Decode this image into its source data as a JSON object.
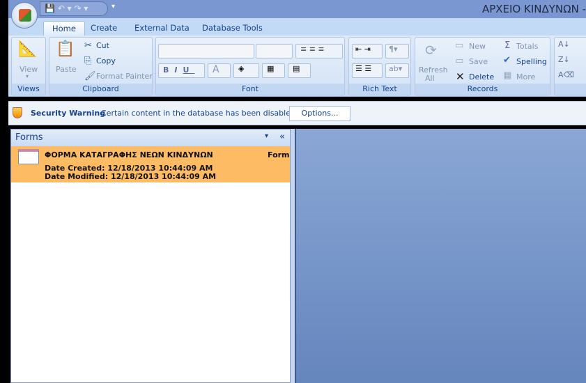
{
  "window": {
    "title": "ΑΡΧΕΙΟ ΚΙΝΔΥΝΩΝ -"
  },
  "tabs": [
    "Home",
    "Create",
    "External Data",
    "Database Tools"
  ],
  "ribbon": {
    "views": {
      "label": "Views",
      "view": "View"
    },
    "clipboard": {
      "label": "Clipboard",
      "paste": "Paste",
      "cut": "Cut",
      "copy": "Copy",
      "format_painter": "Format Painter"
    },
    "font": {
      "label": "Font",
      "bold": "B",
      "italic": "I",
      "underline": "U",
      "font_color": "A"
    },
    "rich_text": {
      "label": "Rich Text"
    },
    "records": {
      "label": "Records",
      "refresh": "Refresh",
      "refresh2": "All",
      "new": "New",
      "save": "Save",
      "delete": "Delete",
      "totals": "Totals",
      "spelling": "Spelling",
      "more": "More"
    }
  },
  "security": {
    "title": "Security Warning",
    "message": "Certain content in the database has been disabled",
    "options": "Options..."
  },
  "nav": {
    "header": "Forms",
    "items": [
      {
        "name": "ΦΟΡΜΑ ΚΑΤΑΓΡΑΦΗΣ ΝΕΩΝ ΚΙΝΔΥΝΩΝ",
        "type": "Form",
        "created": "Date Created: 12/18/2013 10:44:09 AM",
        "modified": "Date Modified: 12/18/2013 10:44:09 AM"
      }
    ]
  },
  "colors": {
    "selected_item": "#fdbc63",
    "title_bar": "#7b97d1",
    "main_bg": "#7696cb"
  }
}
